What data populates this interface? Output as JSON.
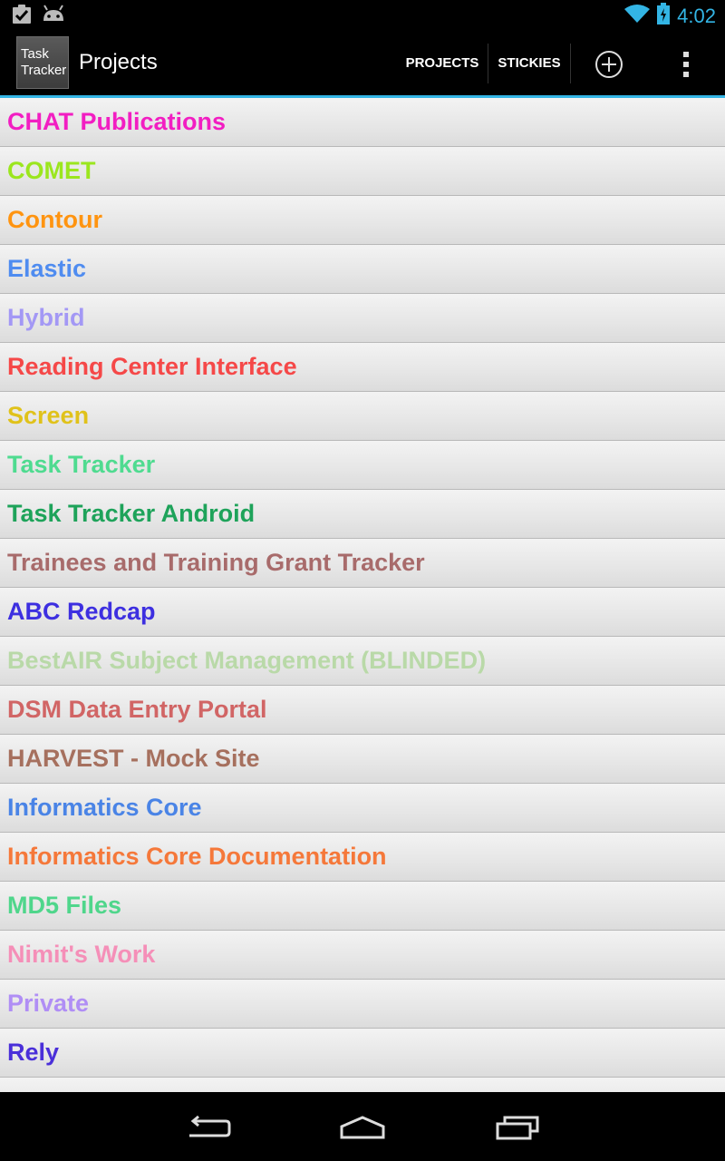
{
  "status_bar": {
    "time": "4:02",
    "icons": [
      "clipboard-check-icon",
      "android-icon",
      "wifi-icon",
      "battery-charging-icon"
    ]
  },
  "action_bar": {
    "logo_line1": "Task",
    "logo_line2": "Tracker",
    "title": "Projects",
    "projects_label": "PROJECTS",
    "stickies_label": "STICKIES",
    "add_icon": "add-circle-icon",
    "overflow_icon": "overflow-menu-icon"
  },
  "projects": [
    {
      "name": "CHAT Publications",
      "color": "#f21ec2"
    },
    {
      "name": "COMET",
      "color": "#9be61e"
    },
    {
      "name": "Contour",
      "color": "#ff9410"
    },
    {
      "name": "Elastic",
      "color": "#4f8cf0"
    },
    {
      "name": "Hybrid",
      "color": "#a398f5"
    },
    {
      "name": "Reading Center Interface",
      "color": "#f54848"
    },
    {
      "name": "Screen",
      "color": "#e0c21a"
    },
    {
      "name": "Task Tracker",
      "color": "#4fdb90"
    },
    {
      "name": "Task Tracker Android",
      "color": "#1ea35a"
    },
    {
      "name": "Trainees and Training Grant Tracker",
      "color": "#a86b6b"
    },
    {
      "name": "ABC Redcap",
      "color": "#3d2fe0"
    },
    {
      "name": "BestAIR Subject Management (BLINDED)",
      "color": "#b9d9a8"
    },
    {
      "name": "DSM Data Entry Portal",
      "color": "#d16565"
    },
    {
      "name": "HARVEST - Mock Site",
      "color": "#a6705e"
    },
    {
      "name": "Informatics Core",
      "color": "#4a84e6"
    },
    {
      "name": "Informatics Core Documentation",
      "color": "#f5783a"
    },
    {
      "name": "MD5 Files",
      "color": "#4fd68b"
    },
    {
      "name": "Nimit's Work",
      "color": "#f58fb8"
    },
    {
      "name": "Private",
      "color": "#b08ef5"
    },
    {
      "name": "Rely",
      "color": "#4a2fd9"
    },
    {
      "name": "",
      "color": "#cccccc"
    }
  ],
  "nav_bar": {
    "back_icon": "back-icon",
    "home_icon": "home-icon",
    "recents_icon": "recents-icon"
  }
}
